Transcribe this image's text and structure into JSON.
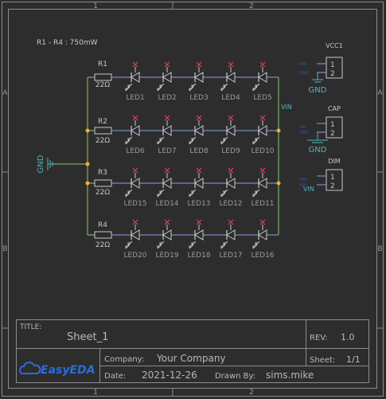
{
  "border": {
    "cols": [
      "1",
      "2"
    ],
    "rows": [
      "A",
      "B"
    ]
  },
  "note": "R1 - R4 : 750mW",
  "resistors": [
    {
      "ref": "R1",
      "value": "22Ω"
    },
    {
      "ref": "R2",
      "value": "22Ω"
    },
    {
      "ref": "R3",
      "value": "22Ω"
    },
    {
      "ref": "R4",
      "value": "22Ω"
    }
  ],
  "led_rows": [
    [
      "LED1",
      "LED2",
      "LED3",
      "LED4",
      "LED5"
    ],
    [
      "LED6",
      "LED7",
      "LED8",
      "LED9",
      "LED10"
    ],
    [
      "LED15",
      "LED14",
      "LED13",
      "LED12",
      "LED11"
    ],
    [
      "LED20",
      "LED19",
      "LED18",
      "LED17",
      "LED16"
    ]
  ],
  "nets": {
    "gnd_left": "GND",
    "vin_right": "VIN"
  },
  "connectors": [
    {
      "ref": "VCC1",
      "pin1": "1",
      "pin2": "2",
      "ports": [
        "VIN",
        "GND"
      ],
      "net_below": "GND"
    },
    {
      "ref": "CAP",
      "pin1": "1",
      "pin2": "2",
      "ports": [
        "VIN",
        "GND"
      ],
      "net_below": "GND"
    },
    {
      "ref": "DIM",
      "pin1": "1",
      "pin2": "2",
      "ports": [
        "VIN",
        "VIN"
      ],
      "net_below": "VIN"
    }
  ],
  "title_block": {
    "title_label": "TITLE:",
    "title": "Sheet_1",
    "rev_label": "REV:",
    "rev": "1.0",
    "company_label": "Company:",
    "company": "Your Company",
    "sheet_label": "Sheet:",
    "sheet": "1/1",
    "date_label": "Date:",
    "date": "2021-12-26",
    "drawn_label": "Drawn By:",
    "drawn_by": "sims.mike",
    "logo": "EasyEDA"
  },
  "colors": {
    "background": "#2d2d2d",
    "border": "#8c8c8c",
    "wire_green": "#8fc86b",
    "wire_blue": "#8aa0e6",
    "component": "#c8c8c8",
    "no_connect": "#d9415a",
    "junction": "#f0b030",
    "net_label": "#4fb3bf",
    "logo": "#2c6cd6"
  }
}
